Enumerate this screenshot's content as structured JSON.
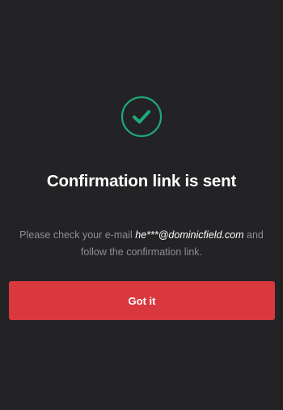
{
  "dialog": {
    "icon": "check-circle-icon",
    "accent_color": "#1fa97a",
    "title": "Confirmation link is sent",
    "message_before": "Please check your e-mail ",
    "email": "he***@dominicfield.com",
    "message_after": " and follow the confirmation link.",
    "button_label": "Got it",
    "button_color": "#d9383f"
  }
}
